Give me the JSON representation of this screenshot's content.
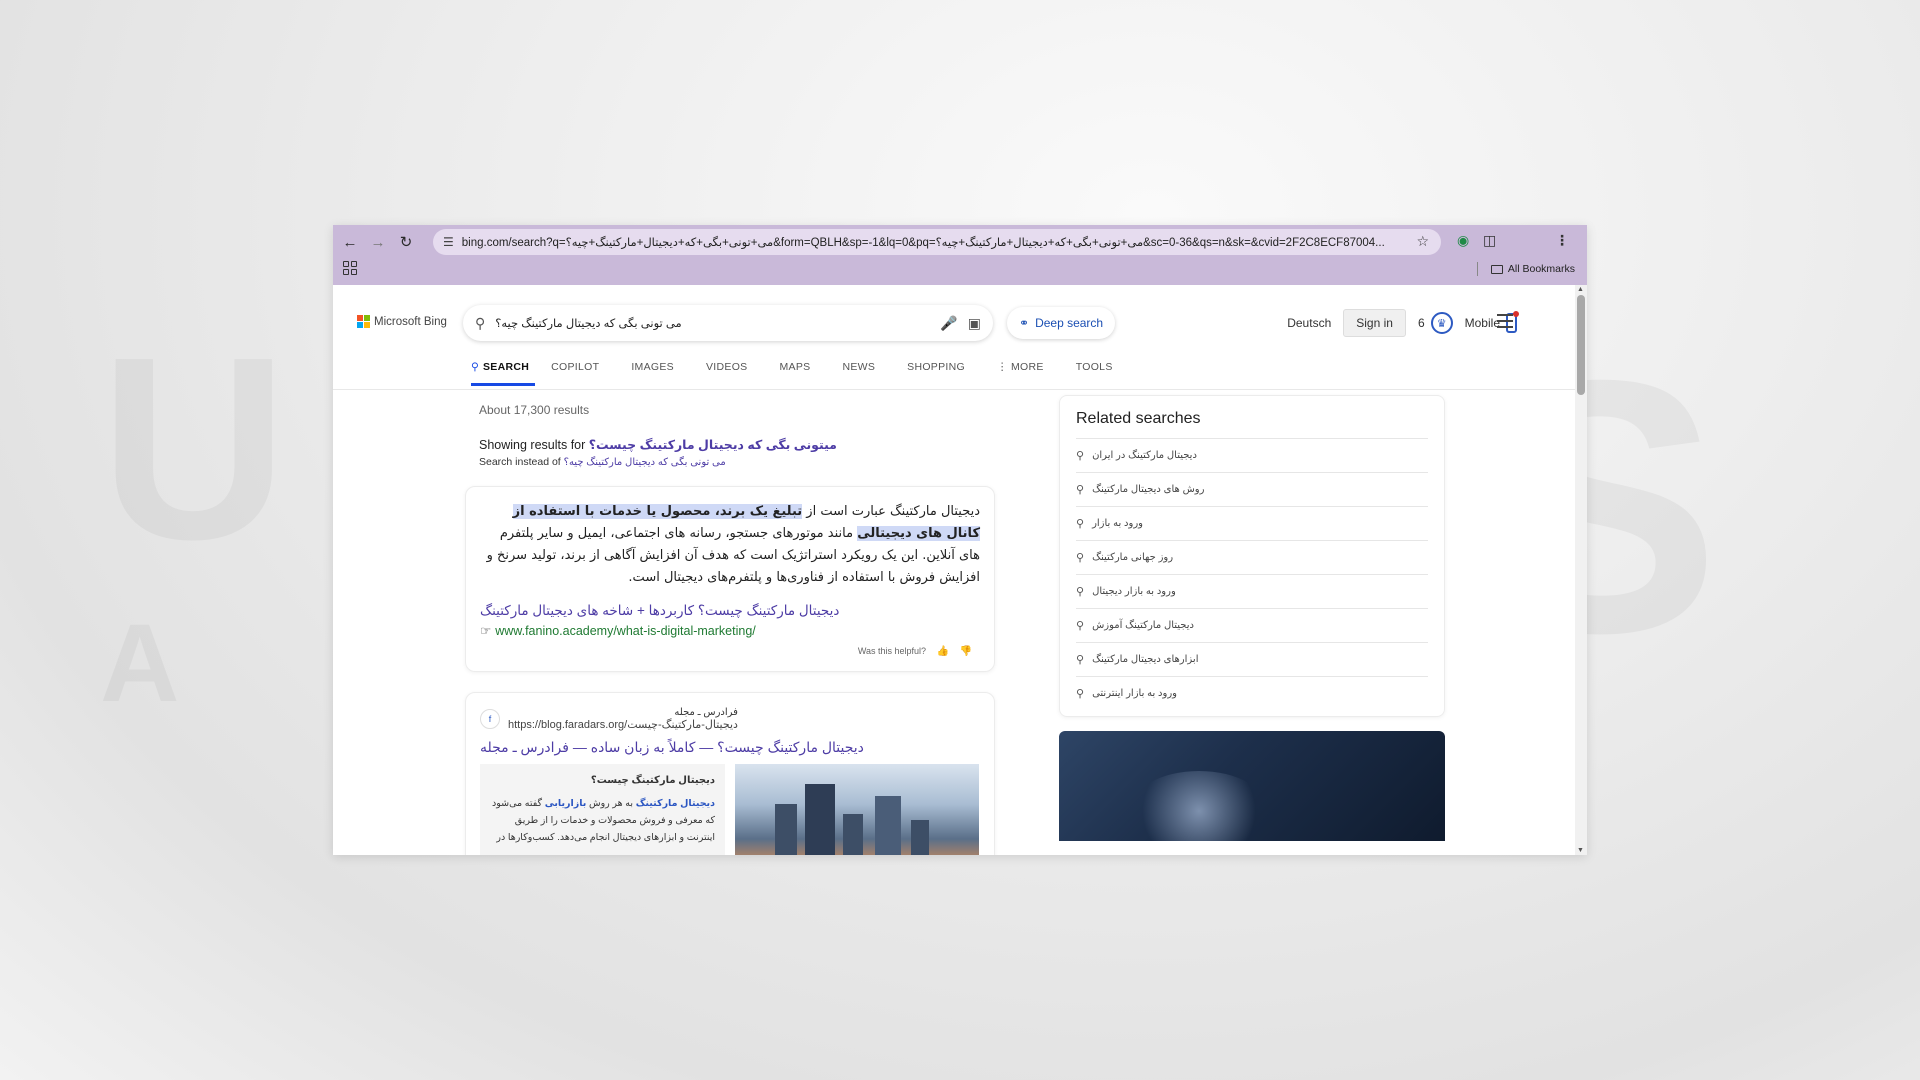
{
  "browser": {
    "url": "bing.com/search?q=می+تونی+بگی+که+دیجیتال+مارکتینگ+چیه؟&form=QBLH&sp=-1&lq=0&pq=می+تونی+بگی+که+دیجیتال+مارکتینگ+چیه؟&sc=0-36&qs=n&sk=&cvid=2F2C8ECF87004...",
    "all_bookmarks": "All Bookmarks"
  },
  "header": {
    "logo_text": "Microsoft Bing",
    "query": "می تونی بگی که دیجیتال مارکتینگ چیه؟",
    "deep_search": "Deep search",
    "language": "Deutsch",
    "sign_in": "Sign in",
    "rewards_count": "6",
    "mobile": "Mobile"
  },
  "tabs": [
    "SEARCH",
    "COPILOT",
    "IMAGES",
    "VIDEOS",
    "MAPS",
    "NEWS",
    "SHOPPING",
    "MORE",
    "TOOLS"
  ],
  "results": {
    "count": "About 17,300 results",
    "showing_prefix": "Showing results for",
    "showing_query": "میتونی بگی که دیجیتال مارکتینگ چیست؟",
    "instead_prefix": "Search instead of",
    "instead_query": "می تونی بگی که دیجیتال مارکتینگ چیه؟"
  },
  "answer": {
    "text_start": "دیجیتال مارکتینگ عبارت است از ",
    "highlight": "تبلیغ یک برند، محصول یا خدمات با استفاده از کانال های دیجیتالی",
    "text_end": " مانند موتورهای جستجو، رسانه های اجتماعی، ایمیل و سایر پلتفرم های آنلاین. این یک رویکرد استراتژیک است که هدف آن افزایش آگاهی از برند، تولید سرنخ و افزایش فروش با استفاده از فناوری‌ها و پلتفرم‌های دیجیتال است.",
    "link_title": "دیجیتال مارکتینگ چیست؟ کاربردها + شاخه های دیجیتال مارکتینگ",
    "link_url": "www.fanino.academy/what-is-digital-marketing/",
    "helpful": "Was this helpful?"
  },
  "result2": {
    "source_name": "فرادرس ـ مجله",
    "source_url": "https://blog.faradars.org/دیجیتال-مارکتینگ-چیست",
    "title": "دیجیتال مارکتینگ چیست؟ — کاملاً به زبان ساده — فرادرس ـ مجله",
    "snippet_title": "دیجیتال مارکتینگ چیست؟",
    "snippet_kw1": "دیجیتال مارکتینگ",
    "snippet_mid": " به هر روش ",
    "snippet_kw2": "بازاریابی",
    "snippet_rest": " گفته می‌شود که معرفی و فروش محصولات و خدمات را از طریق اینترنت و ابزارهای دیجیتال انجام می‌دهد. کسب‌وکارها در"
  },
  "related": {
    "title": "Related searches",
    "items": [
      "دیجیتال مارکتینگ در ایران",
      "روش های دیجیتال مارکتینگ",
      "ورود به بازار",
      "روز جهانی مارکتینگ",
      "ورود به بازار دیجیتال",
      "دیجیتال مارکتینگ آموزش",
      "ابزارهای دیجیتال مارکتینگ",
      "ورود به بازار اینترنتی"
    ]
  },
  "colors": {
    "chrome": "#c9b9d9",
    "link": "#4d3ca5",
    "accent": "#174ae4",
    "url_green": "#1f7a32"
  }
}
